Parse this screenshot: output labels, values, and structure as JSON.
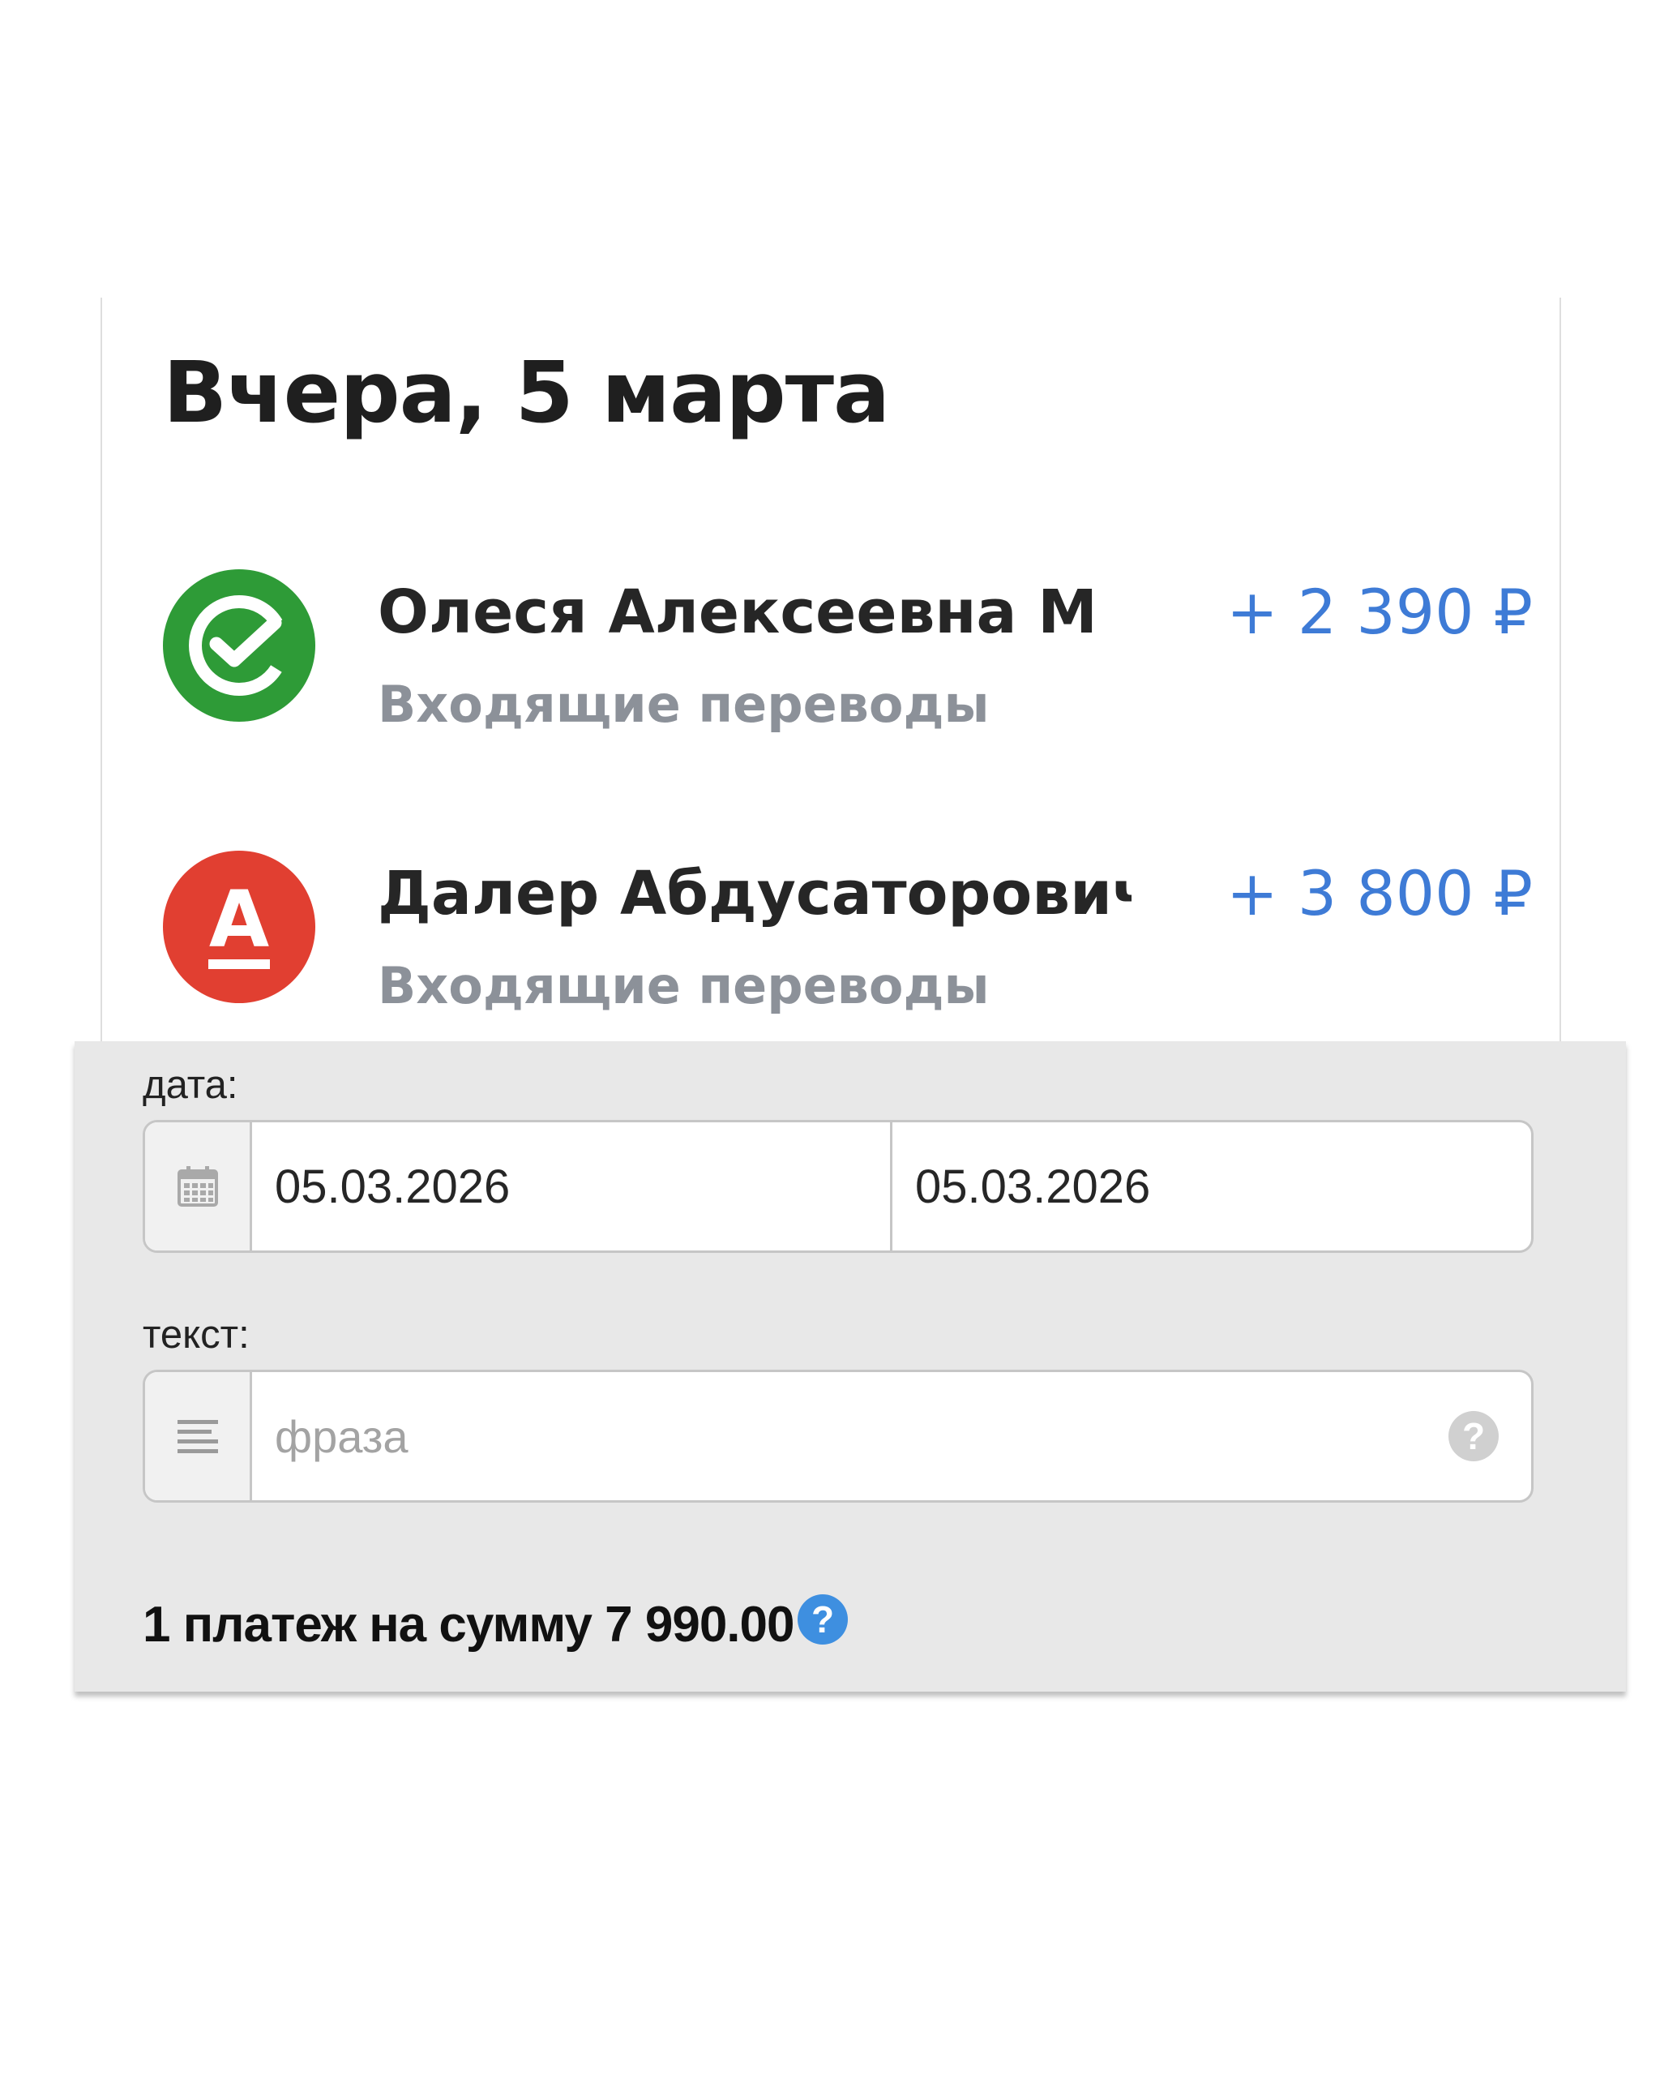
{
  "feed": {
    "date_heading": "Вчера, 5 марта",
    "transactions": [
      {
        "name": "Олеся Алексеевна М",
        "category": "Входящие переводы",
        "amount": "+ 2 390 ₽",
        "bank_icon": "sberbank-logo-icon"
      },
      {
        "name": "Далер Абдусаторович Д",
        "category": "Входящие переводы",
        "amount": "+ 3 800 ₽",
        "bank_icon": "alfa-bank-logo-icon",
        "logo_letter": "А"
      }
    ]
  },
  "filters": {
    "date_label": "дата:",
    "date_from": "05.03.2026",
    "date_to": "05.03.2026",
    "text_label": "текст:",
    "text_placeholder": "фраза",
    "text_value": "",
    "help_symbol": "?",
    "summary": "1 платеж на сумму 7 990.00 ₽",
    "summary_help_symbol": "?"
  },
  "colors": {
    "amount": "#3e7bd6",
    "sber_green": "#2e9b37",
    "alfa_red": "#e13f31",
    "panel_bg": "#e8e8e8",
    "help_blue": "#3e8fe0"
  }
}
